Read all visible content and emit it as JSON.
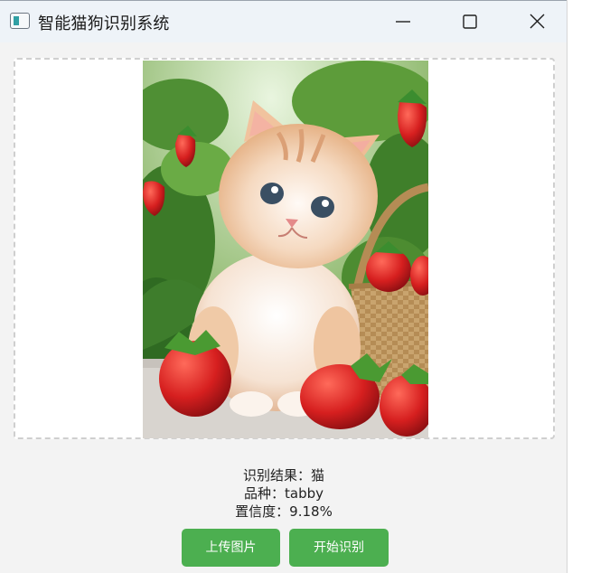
{
  "window": {
    "title": "智能猫狗识别系统"
  },
  "image": {
    "description_icon": "kitten-strawberries-photo"
  },
  "result": {
    "label_result": "识别结果：猫",
    "label_breed": "品种：tabby",
    "label_confidence": "置信度：9.18%"
  },
  "actions": {
    "upload_label": "上传图片",
    "start_label": "开始识别"
  },
  "colors": {
    "button": "#4caf50",
    "titlebar": "#eef3f8",
    "dash": "#cfcfcf"
  }
}
